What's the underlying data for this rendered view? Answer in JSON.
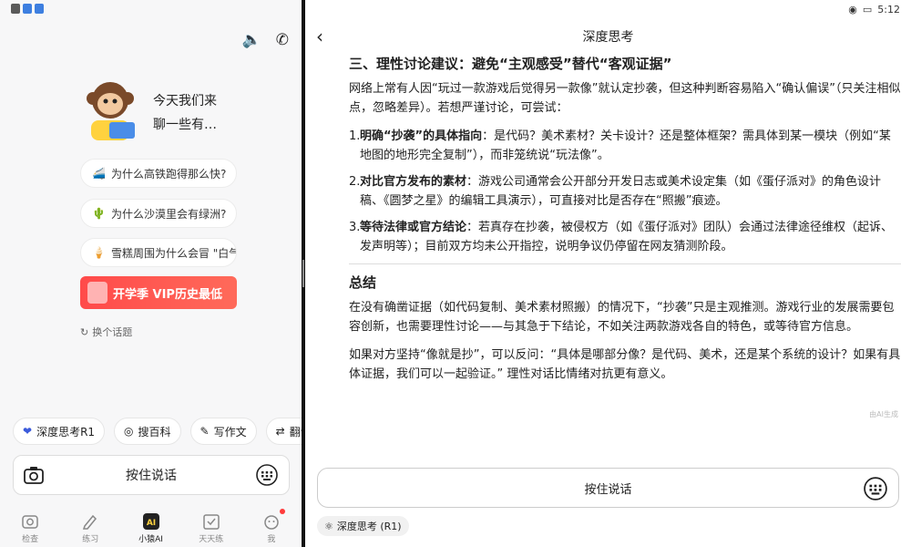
{
  "left": {
    "greeting_line1": "今天我们来",
    "greeting_line2": "聊一些有…",
    "suggestions": [
      {
        "icon": "🚄",
        "text": "为什么高铁跑得那么快?"
      },
      {
        "icon": "🌵",
        "text": "为什么沙漠里会有绿洲?"
      },
      {
        "icon": "🍦",
        "text": "雪糕周围为什么会冒 \"白气"
      }
    ],
    "banner_text": "开学季 VIP历史最低",
    "refresh_label": "换个话题",
    "chips": [
      {
        "icon": "deep-think-icon",
        "label": "深度思考R1"
      },
      {
        "icon": "baike-icon",
        "label": "搜百科"
      },
      {
        "icon": "write-icon",
        "label": "写作文"
      },
      {
        "icon": "translate-icon",
        "label": "翻译"
      }
    ],
    "voice_label": "按住说话",
    "tabs": [
      {
        "label": "检查",
        "icon": "camera-tab-icon"
      },
      {
        "label": "练习",
        "icon": "pencil-tab-icon"
      },
      {
        "label": "小猿AI",
        "icon": "ai-tab-icon"
      },
      {
        "label": "天天练",
        "icon": "check-tab-icon"
      },
      {
        "label": "我",
        "icon": "profile-tab-icon"
      }
    ]
  },
  "right": {
    "status_time": "5:12",
    "title": "深度思考",
    "section3_heading": "三、理性讨论建议：避免“主观感受”替代“客观证据”",
    "section3_intro": "网络上常有人因“玩过一款游戏后觉得另一款像”就认定抄袭，但这种判断容易陷入“确认偏误”（只关注相似点，忽略差异）。若想严谨讨论，可尝试：",
    "items": [
      {
        "num": "1.",
        "bold": "明确“抄袭”的具体指向",
        "text": "：是代码？美术素材？关卡设计？还是整体框架？需具体到某一模块（例如“某地图的地形完全复制”），而非笼统说“玩法像”。"
      },
      {
        "num": "2.",
        "bold": "对比官方发布的素材",
        "text": "：游戏公司通常会公开部分开发日志或美术设定集（如《蛋仔派对》的角色设计稿、《圆梦之星》的编辑工具演示），可直接对比是否存在“照搬”痕迹。"
      },
      {
        "num": "3.",
        "bold": "等待法律或官方结论",
        "text": "：若真存在抄袭，被侵权方（如《蛋仔派对》团队）会通过法律途径维权（起诉、发声明等）；目前双方均未公开指控，说明争议仍停留在网友猜测阶段。"
      }
    ],
    "summary_heading": "总结",
    "summary_p1": "在没有确凿证据（如代码复制、美术素材照搬）的情况下，“抄袭”只是主观推测。游戏行业的发展需要包容创新，也需要理性讨论——与其急于下结论，不如关注两款游戏各自的特色，或等待官方信息。",
    "summary_p2": "如果对方坚持“像就是抄”，可以反问：“具体是哪部分像？是代码、美术，还是某个系统的设计？如果有具体证据，我们可以一起验证。” 理性对话比情绪对抗更有意义。",
    "watermark": "由AI生成",
    "voice_label": "按住说话",
    "mode_chip": "深度思考 (R1)"
  }
}
